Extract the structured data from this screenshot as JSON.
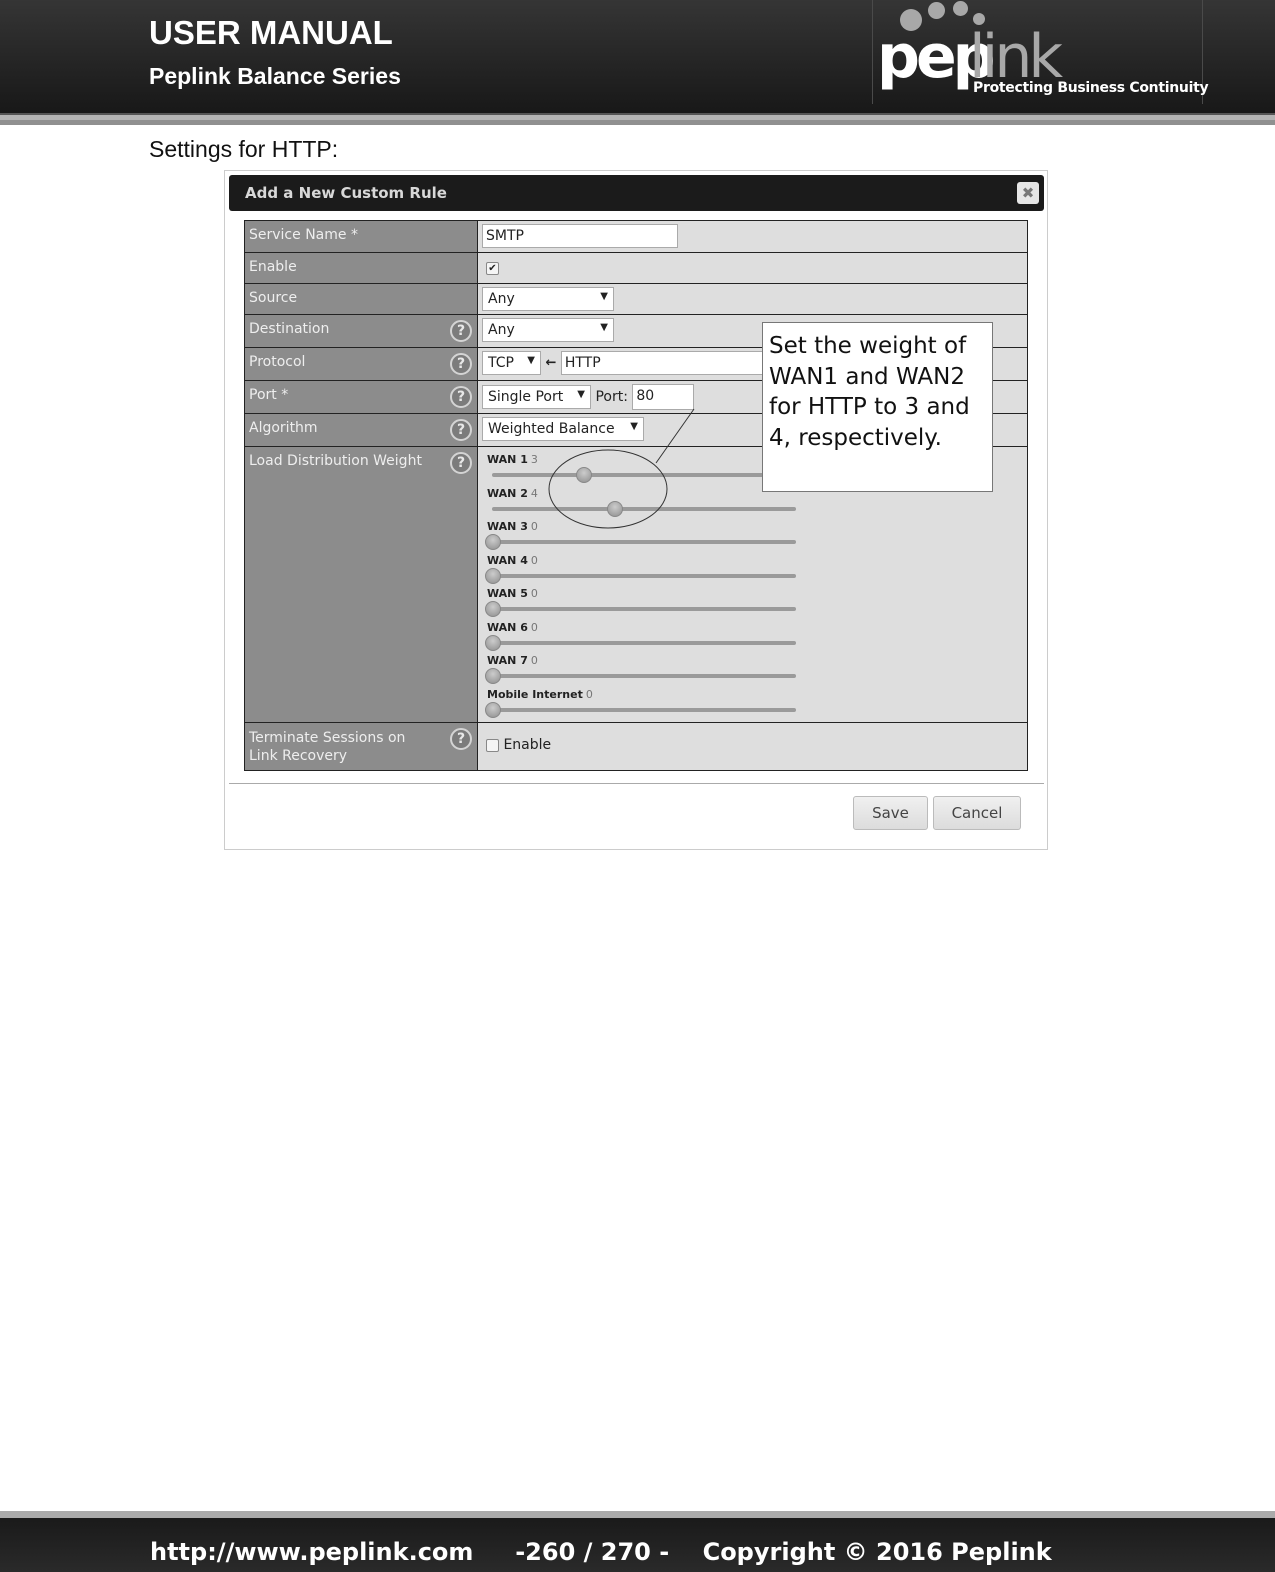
{
  "header": {
    "title": "USER MANUAL",
    "subtitle": "Peplink Balance Series",
    "logo": {
      "brand_bold": "pep",
      "brand_light": "link",
      "tagline": "Protecting Business Continuity"
    }
  },
  "intro_text": "Settings for HTTP:",
  "dialog": {
    "title": "Add a New Custom Rule",
    "close_icon": "close-icon",
    "rows": {
      "service_name": {
        "label": "Service Name *",
        "value": "SMTP"
      },
      "enable": {
        "label": "Enable",
        "checked": true,
        "check_glyph": "✔"
      },
      "source": {
        "label": "Source",
        "value": "Any"
      },
      "destination": {
        "label": "Destination",
        "value": "Any"
      },
      "protocol": {
        "label": "Protocol",
        "value": "TCP",
        "arrow": "🡐",
        "service": "HTTP"
      },
      "port": {
        "label": "Port *",
        "type": "Single Port",
        "port_label": "Port:",
        "port_value": "80"
      },
      "algorithm": {
        "label": "Algorithm",
        "value": "Weighted Balance"
      },
      "load_distribution": {
        "label": "Load Distribution Weight",
        "slider_max": 10,
        "sliders": [
          {
            "name": "WAN 1",
            "value": "3"
          },
          {
            "name": "WAN 2",
            "value": "4"
          },
          {
            "name": "WAN 3",
            "value": "0"
          },
          {
            "name": "WAN 4",
            "value": "0"
          },
          {
            "name": "WAN 5",
            "value": "0"
          },
          {
            "name": "WAN 6",
            "value": "0"
          },
          {
            "name": "WAN 7",
            "value": "0"
          },
          {
            "name": "Mobile Internet",
            "value": "0"
          }
        ]
      },
      "terminate_sessions": {
        "label": "Terminate Sessions on Link Recovery",
        "option": "Enable",
        "checked": false
      }
    },
    "help_glyph": "?",
    "dropdown_arrow": "▼",
    "buttons": {
      "save": "Save",
      "cancel": "Cancel"
    }
  },
  "callout": "Set the weight of WAN1 and WAN2 for HTTP to 3 and 4, respectively.",
  "footer": {
    "url": "http://www.peplink.com",
    "page": "-260 / 270 -",
    "copyright": "Copyright © 2016 Peplink"
  }
}
